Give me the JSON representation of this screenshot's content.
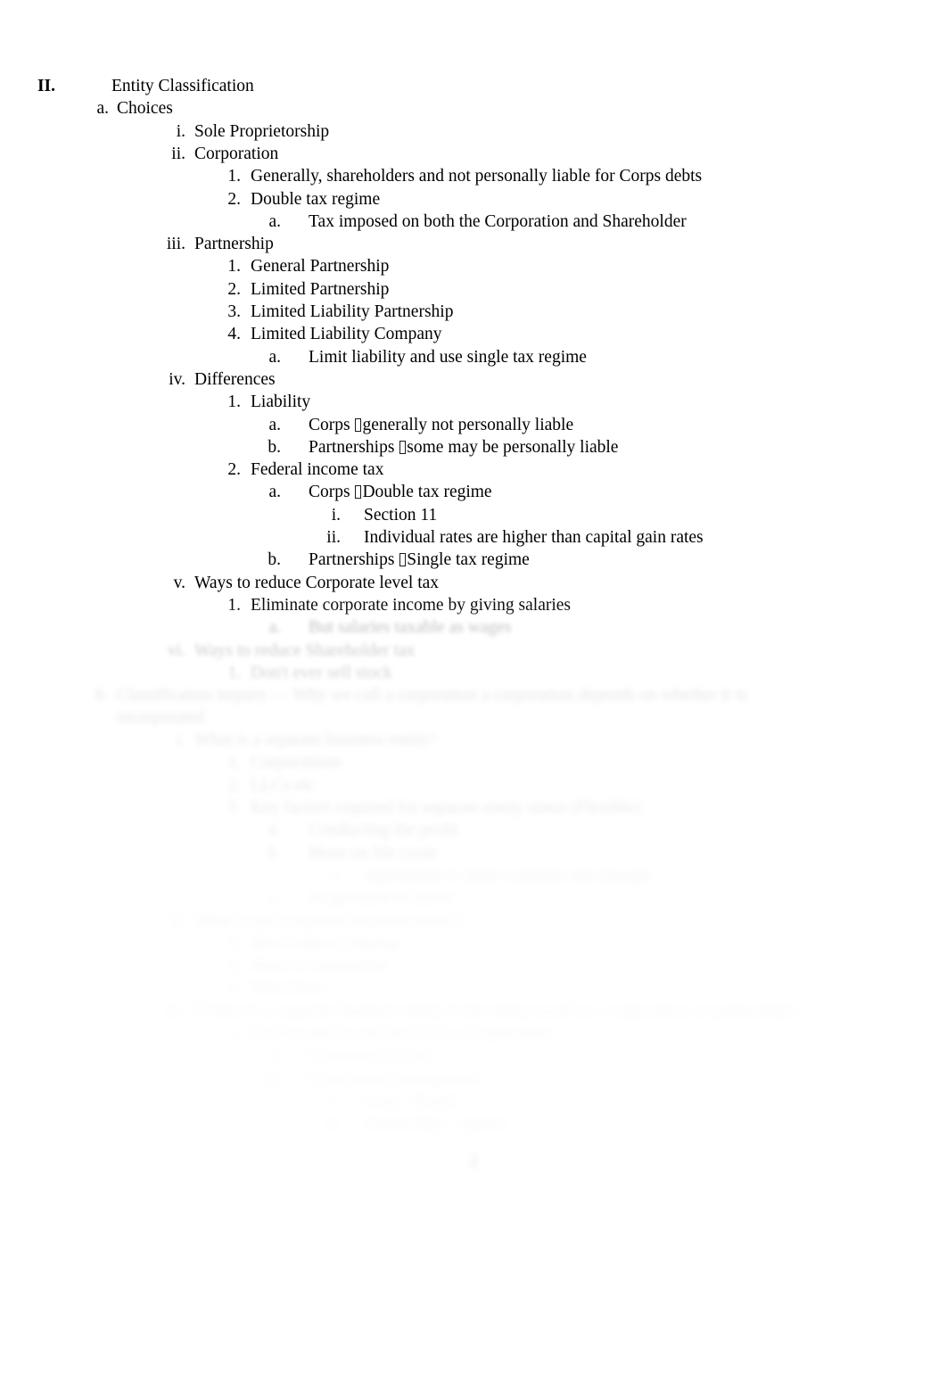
{
  "document": {
    "type": "outline-notes",
    "page_number": "2",
    "background_color": "#ffffff",
    "text_color": "#000000",
    "blur_note": "lower portion of page is progressively blurred and faded out"
  },
  "outline": [
    {
      "level": 0,
      "marker": "II.",
      "text": "Entity Classification",
      "bold_marker": true,
      "blur": "none"
    },
    {
      "level": 1,
      "marker": "a.",
      "text": "Choices",
      "blur": "none"
    },
    {
      "level": 2,
      "marker": "i.",
      "text": "Sole Proprietorship",
      "blur": "none"
    },
    {
      "level": 2,
      "marker": "ii.",
      "text": "Corporation",
      "blur": "none"
    },
    {
      "level": 3,
      "marker": "1.",
      "text": "Generally, shareholders and not personally liable for Corps debts",
      "blur": "none"
    },
    {
      "level": 3,
      "marker": "2.",
      "text": "Double tax regime",
      "blur": "none"
    },
    {
      "level": 4,
      "marker": "a.",
      "text": "Tax imposed on both the Corporation and Shareholder",
      "blur": "none"
    },
    {
      "level": 2,
      "marker": "iii.",
      "text": "Partnership",
      "blur": "none"
    },
    {
      "level": 3,
      "marker": "1.",
      "text": "General Partnership",
      "blur": "none"
    },
    {
      "level": 3,
      "marker": "2.",
      "text": "Limited Partnership",
      "blur": "none"
    },
    {
      "level": 3,
      "marker": "3.",
      "text": "Limited Liability Partnership",
      "blur": "none"
    },
    {
      "level": 3,
      "marker": "4.",
      "text": "Limited Liability Company",
      "blur": "none"
    },
    {
      "level": 4,
      "marker": "a.",
      "text": "Limit liability and use single tax regime",
      "blur": "none"
    },
    {
      "level": 2,
      "marker": "iv.",
      "text": "Differences",
      "blur": "none"
    },
    {
      "level": 3,
      "marker": "1.",
      "text": "Liability",
      "blur": "none"
    },
    {
      "level": 4,
      "marker": "a.",
      "text_before": "Corps ",
      "tofu": true,
      "text_after": "generally not personally liable",
      "blur": "none"
    },
    {
      "level": 4,
      "marker": "b.",
      "text_before": "Partnerships ",
      "tofu": true,
      "text_after": "some may be personally liable",
      "blur": "none"
    },
    {
      "level": 3,
      "marker": "2.",
      "text": "Federal income tax",
      "blur": "none"
    },
    {
      "level": 4,
      "marker": "a.",
      "text_before": "Corps ",
      "tofu": true,
      "text_after": "Double tax regime",
      "blur": "none"
    },
    {
      "level": 5,
      "marker": "i.",
      "text": "Section 11",
      "blur": "none"
    },
    {
      "level": 5,
      "marker": "ii.",
      "text": "Individual rates are higher than capital gain rates",
      "blur": "none"
    },
    {
      "level": 4,
      "marker": "b.",
      "text_before": "Partnerships ",
      "tofu": true,
      "text_after": "Single tax regime",
      "blur": "none"
    },
    {
      "level": 2,
      "marker": "v.",
      "text": "Ways to reduce Corporate level tax",
      "blur": "none"
    },
    {
      "level": 3,
      "marker": "1.",
      "text": "Eliminate corporate income by giving salaries",
      "blur": "none"
    },
    {
      "level": 4,
      "marker": "a.",
      "text": "But salaries taxable as wages",
      "blur": "light"
    },
    {
      "level": 2,
      "marker": "vi.",
      "text": "Ways to reduce Shareholder tax",
      "blur": "light"
    },
    {
      "level": 3,
      "marker": "1.",
      "text": "Don't ever sell stock",
      "blur": "light"
    },
    {
      "level": 1,
      "marker": "b.",
      "text": "Classification inquiry — Why we call a corporation a corporation depends on whether it is incorporated",
      "blur": "medium",
      "wrap": true
    },
    {
      "level": 2,
      "marker": "i.",
      "text": "What is a separate business entity?",
      "blur": "medium"
    },
    {
      "level": 3,
      "marker": "1.",
      "text": "Corporations",
      "blur": "medium"
    },
    {
      "level": 3,
      "marker": "2.",
      "text": "LLCs etc",
      "blur": "medium"
    },
    {
      "level": 3,
      "marker": "3.",
      "text": "Key factors required for separate entity status (Flexible)",
      "blur": "medium"
    },
    {
      "level": 4,
      "marker": "a.",
      "text": "Conducting the profit",
      "blur": "medium"
    },
    {
      "level": 4,
      "marker": "b.",
      "text": "More on life cycle",
      "blur": "medium"
    },
    {
      "level": 5,
      "marker": "i.",
      "text": "Agreement to share expenses not enough",
      "blur": "heavy"
    },
    {
      "level": 4,
      "marker": "c.",
      "text": "Acquisition of assets",
      "blur": "heavy"
    },
    {
      "level": 2,
      "marker": "ii.",
      "text": "What is not a separate business entity?",
      "blur": "heavy"
    },
    {
      "level": 3,
      "marker": "1.",
      "text": "Mere indirect sharing",
      "blur": "heavy"
    },
    {
      "level": 3,
      "marker": "2.",
      "text": "Mere co-ownership",
      "blur": "heavy"
    },
    {
      "level": 3,
      "marker": "3.",
      "text": "Mere lease",
      "blur": "heavy"
    },
    {
      "level": 2,
      "marker": "iii.",
      "text": "If there is a separate business entity, is the entity taxed as a corporation or partnership?",
      "blur": "heavy"
    },
    {
      "level": 3,
      "marker": "1.",
      "text": "Factors used to decide if it is a Corporation",
      "blur": "heavy"
    },
    {
      "level": 4,
      "marker": "a.",
      "text": "Continuity of life",
      "blur": "heavy"
    },
    {
      "level": 4,
      "marker": "b.",
      "text": "Centralized management",
      "blur": "heavy"
    },
    {
      "level": 5,
      "marker": "i.",
      "text": "Corp - Board",
      "blur": "heavy"
    },
    {
      "level": 5,
      "marker": "ii.",
      "text": "Partnership - Agents",
      "blur": "heavy"
    }
  ]
}
